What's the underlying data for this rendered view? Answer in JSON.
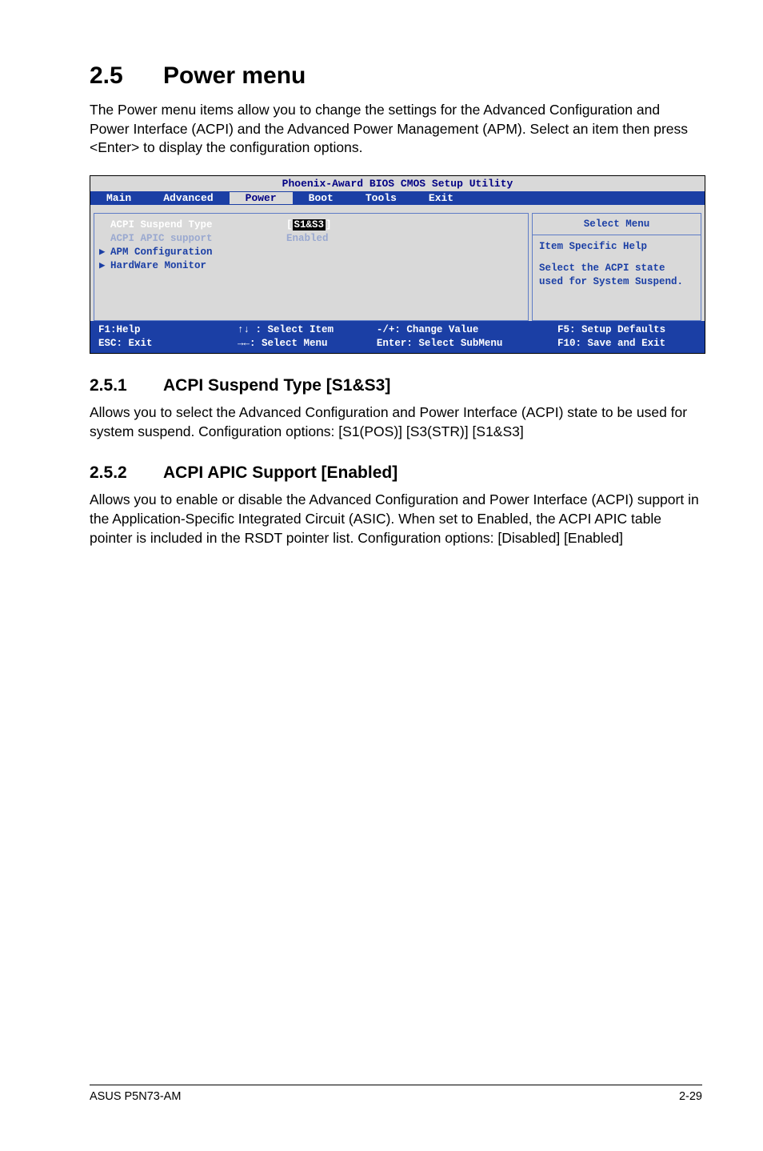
{
  "title": {
    "num": "2.5",
    "text": "Power menu"
  },
  "intro": "The Power menu items allow you to change the settings for the Advanced Configuration and Power Interface (ACPI) and the Advanced Power Management (APM). Select an item then press <Enter> to display the configuration options.",
  "bios": {
    "banner": "Phoenix-Award BIOS CMOS Setup Utility",
    "tabs": {
      "main": "Main",
      "advanced": "Advanced",
      "power": "Power",
      "boot": "Boot",
      "tools": "Tools",
      "exit": "Exit"
    },
    "rows": {
      "r0": {
        "label": "ACPI Suspend Type",
        "value": "S1&S3"
      },
      "r1": {
        "label": "ACPI APIC support",
        "value": "Enabled"
      },
      "r2": {
        "label": "APM Configuration"
      },
      "r3": {
        "label": "HardWare Monitor"
      }
    },
    "help": {
      "title": "Select Menu",
      "line1": "Item Specific Help",
      "line2": "Select the ACPI state used for System Suspend."
    },
    "footer": {
      "c1a": "F1:Help",
      "c1b": "ESC: Exit",
      "c2a": "↑↓ : Select Item",
      "c2b": "→←: Select Menu",
      "c3a": "-/+: Change Value",
      "c3b": "Enter: Select SubMenu",
      "c4a": "F5: Setup Defaults",
      "c4b": "F10: Save and Exit"
    }
  },
  "s251": {
    "num": "2.5.1",
    "title": "ACPI Suspend Type [S1&S3]",
    "body": "Allows you to select the Advanced Configuration and Power Interface (ACPI) state to be used for system suspend. Configuration options: [S1(POS)] [S3(STR)] [S1&S3]"
  },
  "s252": {
    "num": "2.5.2",
    "title": "ACPI APIC Support [Enabled]",
    "body": "Allows you to enable or disable the Advanced Configuration and Power Interface (ACPI) support in the Application-Specific Integrated Circuit (ASIC). When set to Enabled, the ACPI APIC table pointer is included in the RSDT pointer list. Configuration options: [Disabled] [Enabled]"
  },
  "footer": {
    "left": "ASUS P5N73-AM",
    "right": "2-29"
  }
}
